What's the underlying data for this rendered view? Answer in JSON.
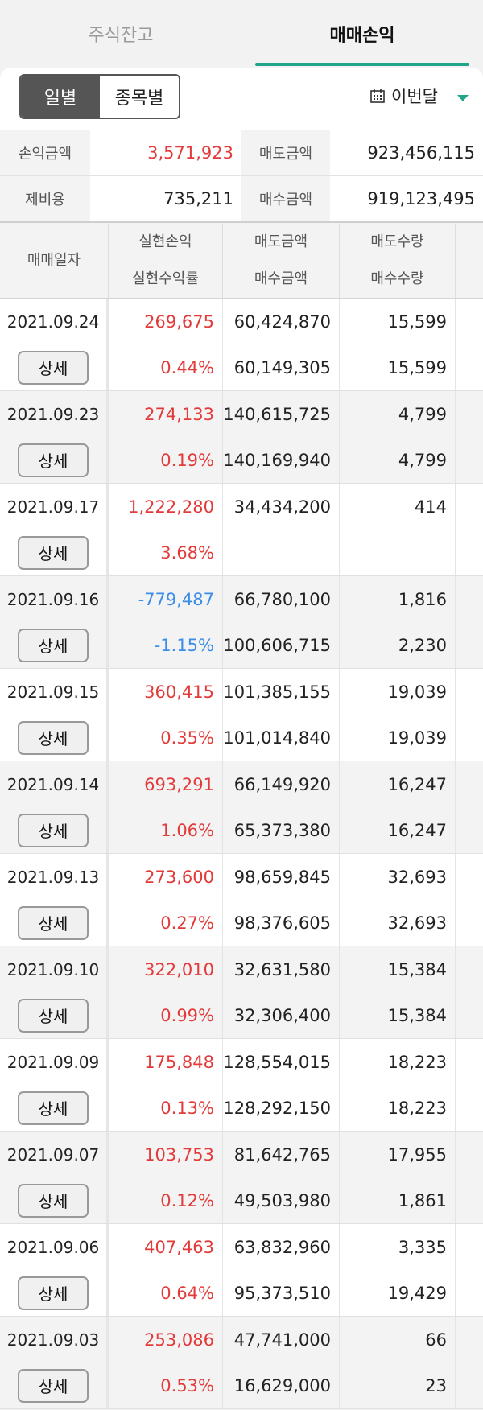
{
  "tabs": [
    {
      "label": "주식잔고",
      "active": false
    },
    {
      "label": "매매손익",
      "active": true
    }
  ],
  "filter": {
    "seg_day": "일별",
    "seg_stock": "종목별",
    "period": "이번달",
    "calendar_icon": "calendar-icon",
    "accent_color": "#1fa58a"
  },
  "summary": {
    "pnl_label": "손익금액",
    "pnl_value": "3,571,923",
    "sell_label": "매도금액",
    "sell_value": "923,456,115",
    "fee_label": "제비용",
    "fee_value": "735,211",
    "buy_label": "매수금액",
    "buy_value": "919,123,495"
  },
  "table": {
    "headers": {
      "date": "매매일자",
      "realized": "실현손익",
      "rate": "실현수익률",
      "sell_amt": "매도금액",
      "buy_amt": "매수금액",
      "sell_qty": "매도수량",
      "buy_qty": "매수수량"
    },
    "detail_label": "상세",
    "rows": [
      {
        "date": "2021.09.24",
        "pnl": "269,675",
        "rate": "0.44%",
        "sell_amt": "60,424,870",
        "buy_amt": "60,149,305",
        "sell_qty": "15,599",
        "buy_qty": "15,599",
        "sign": "pos"
      },
      {
        "date": "2021.09.23",
        "pnl": "274,133",
        "rate": "0.19%",
        "sell_amt": "140,615,725",
        "buy_amt": "140,169,940",
        "sell_qty": "4,799",
        "buy_qty": "4,799",
        "sign": "pos"
      },
      {
        "date": "2021.09.17",
        "pnl": "1,222,280",
        "rate": "3.68%",
        "sell_amt": "34,434,200",
        "buy_amt": "",
        "sell_qty": "414",
        "buy_qty": "",
        "sign": "pos"
      },
      {
        "date": "2021.09.16",
        "pnl": "-779,487",
        "rate": "-1.15%",
        "sell_amt": "66,780,100",
        "buy_amt": "100,606,715",
        "sell_qty": "1,816",
        "buy_qty": "2,230",
        "sign": "neg"
      },
      {
        "date": "2021.09.15",
        "pnl": "360,415",
        "rate": "0.35%",
        "sell_amt": "101,385,155",
        "buy_amt": "101,014,840",
        "sell_qty": "19,039",
        "buy_qty": "19,039",
        "sign": "pos"
      },
      {
        "date": "2021.09.14",
        "pnl": "693,291",
        "rate": "1.06%",
        "sell_amt": "66,149,920",
        "buy_amt": "65,373,380",
        "sell_qty": "16,247",
        "buy_qty": "16,247",
        "sign": "pos"
      },
      {
        "date": "2021.09.13",
        "pnl": "273,600",
        "rate": "0.27%",
        "sell_amt": "98,659,845",
        "buy_amt": "98,376,605",
        "sell_qty": "32,693",
        "buy_qty": "32,693",
        "sign": "pos"
      },
      {
        "date": "2021.09.10",
        "pnl": "322,010",
        "rate": "0.99%",
        "sell_amt": "32,631,580",
        "buy_amt": "32,306,400",
        "sell_qty": "15,384",
        "buy_qty": "15,384",
        "sign": "pos"
      },
      {
        "date": "2021.09.09",
        "pnl": "175,848",
        "rate": "0.13%",
        "sell_amt": "128,554,015",
        "buy_amt": "128,292,150",
        "sell_qty": "18,223",
        "buy_qty": "18,223",
        "sign": "pos"
      },
      {
        "date": "2021.09.07",
        "pnl": "103,753",
        "rate": "0.12%",
        "sell_amt": "81,642,765",
        "buy_amt": "49,503,980",
        "sell_qty": "17,955",
        "buy_qty": "1,861",
        "sign": "pos"
      },
      {
        "date": "2021.09.06",
        "pnl": "407,463",
        "rate": "0.64%",
        "sell_amt": "63,832,960",
        "buy_amt": "95,373,510",
        "sell_qty": "3,335",
        "buy_qty": "19,429",
        "sign": "pos"
      },
      {
        "date": "2021.09.03",
        "pnl": "253,086",
        "rate": "0.53%",
        "sell_amt": "47,741,000",
        "buy_amt": "16,629,000",
        "sell_qty": "66",
        "buy_qty": "23",
        "sign": "pos"
      }
    ]
  },
  "colors": {
    "positive": "#e33a3a",
    "negative": "#3b8ee8"
  }
}
